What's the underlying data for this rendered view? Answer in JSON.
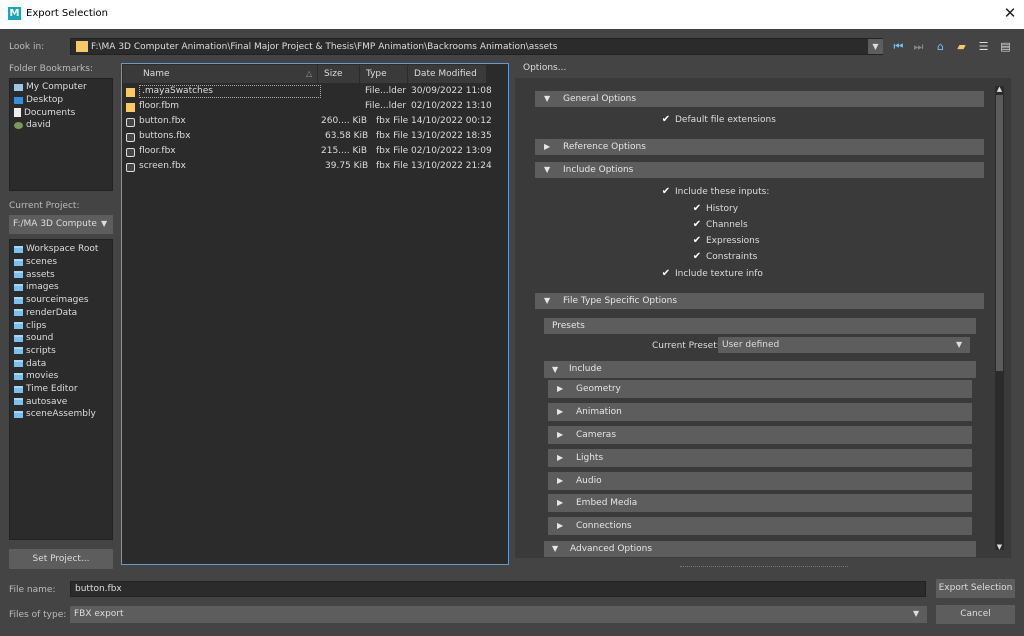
{
  "window": {
    "title": "Export Selection",
    "close": "✕"
  },
  "lookin": {
    "label": "Look in:",
    "path": "F:\\MA 3D Computer Animation\\Final Major Project & Thesis\\FMP Animation\\Backrooms Animation\\assets"
  },
  "bookmarks": {
    "label": "Folder Bookmarks:",
    "items": [
      "My Computer",
      "Desktop",
      "Documents",
      "david"
    ]
  },
  "project": {
    "label": "Current Project:",
    "value": "F:/MA 3D Compute",
    "folders": [
      "Workspace Root",
      "scenes",
      "assets",
      "images",
      "sourceimages",
      "renderData",
      "clips",
      "sound",
      "scripts",
      "data",
      "movies",
      "Time Editor",
      "autosave",
      "sceneAssembly"
    ],
    "set_button": "Set Project..."
  },
  "files": {
    "headers": [
      "Name",
      "Size",
      "Type",
      "Date Modified"
    ],
    "rows": [
      {
        "name": ".mayaSwatches",
        "size": "",
        "type": "File...lder",
        "date": "30/09/2022 11:08",
        "kind": "folder"
      },
      {
        "name": "floor.fbm",
        "size": "",
        "type": "File...lder",
        "date": "02/10/2022 13:10",
        "kind": "folder"
      },
      {
        "name": "button.fbx",
        "size": "260.... KiB",
        "type": "fbx File",
        "date": "14/10/2022 00:12",
        "kind": "fbx"
      },
      {
        "name": "buttons.fbx",
        "size": "63.58 KiB",
        "type": "fbx File",
        "date": "13/10/2022 18:35",
        "kind": "fbx"
      },
      {
        "name": "floor.fbx",
        "size": "215.... KiB",
        "type": "fbx File",
        "date": "02/10/2022 13:09",
        "kind": "fbx"
      },
      {
        "name": "screen.fbx",
        "size": "39.75 KiB",
        "type": "fbx File",
        "date": "13/10/2022 21:24",
        "kind": "fbx"
      }
    ]
  },
  "options": {
    "label": "Options...",
    "general": {
      "title": "General Options",
      "default_ext": "Default file extensions"
    },
    "reference": {
      "title": "Reference Options"
    },
    "include": {
      "title": "Include Options",
      "inputs": "Include these inputs:",
      "history": "History",
      "channels": "Channels",
      "expressions": "Expressions",
      "constraints": "Constraints",
      "texture": "Include texture info"
    },
    "filetype": {
      "title": "File Type Specific Options",
      "presets": "Presets",
      "current_preset_label": "Current Preset:",
      "current_preset": "User defined",
      "include": "Include",
      "subs": [
        "Geometry",
        "Animation",
        "Cameras",
        "Lights",
        "Audio",
        "Embed Media",
        "Connections"
      ],
      "advanced": "Advanced Options"
    }
  },
  "footer": {
    "filename_label": "File name:",
    "filename": "button.fbx",
    "filetype_label": "Files of type:",
    "filetype": "FBX export",
    "export_button": "Export Selection",
    "cancel_button": "Cancel"
  }
}
